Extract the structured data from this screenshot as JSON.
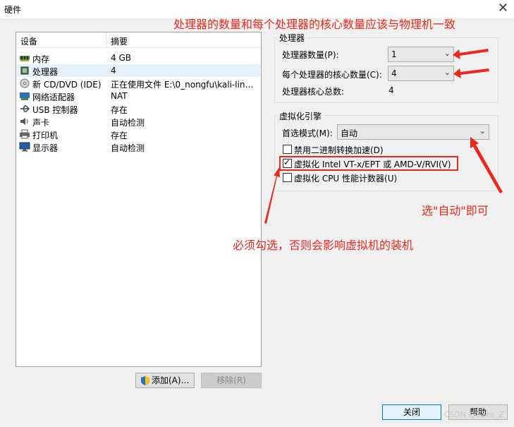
{
  "window": {
    "title": "硬件",
    "close_glyph": "✕"
  },
  "device_list": {
    "col_device": "设备",
    "col_summary": "摘要",
    "rows": [
      {
        "name": "内存",
        "value": "4 GB"
      },
      {
        "name": "处理器",
        "value": "4"
      },
      {
        "name": "新 CD/DVD (IDE)",
        "value": "正在使用文件 E:\\0_nongfu\\kali-linux..."
      },
      {
        "name": "网络适配器",
        "value": "NAT"
      },
      {
        "name": "USB 控制器",
        "value": "存在"
      },
      {
        "name": "声卡",
        "value": "自动检测"
      },
      {
        "name": "打印机",
        "value": "存在"
      },
      {
        "name": "显示器",
        "value": "自动检测"
      }
    ],
    "add_button": "添加(A)...",
    "remove_button": "移除(R)"
  },
  "processor": {
    "group_label": "处理器",
    "count_label": "处理器数量(P):",
    "count_value": "1",
    "cores_label": "每个处理器的核心数量(C):",
    "cores_value": "4",
    "total_label": "处理器核心总数:",
    "total_value": "4"
  },
  "virtualization": {
    "group_label": "虚拟化引擎",
    "mode_label": "首选模式(M):",
    "mode_value": "自动",
    "option1": "禁用二进制转换加速(D)",
    "option1_checked": false,
    "option2": "虚拟化 Intel VT-x/EPT 或 AMD-V/RVI(V)",
    "option2_checked": true,
    "option3": "虚拟化 CPU 性能计数器(U)",
    "option3_checked": false
  },
  "annotations": {
    "top": "处理器的数量和每个处理器的核心数量应该与物理机一致",
    "auto": "选\"自动\"即可",
    "must": "必须勾选，否则会影响虚拟机的装机",
    "color": "#e8291c"
  },
  "footer": {
    "close_button": "关闭",
    "help_button": "帮助",
    "watermark": "CSDN @Sans_Z"
  }
}
